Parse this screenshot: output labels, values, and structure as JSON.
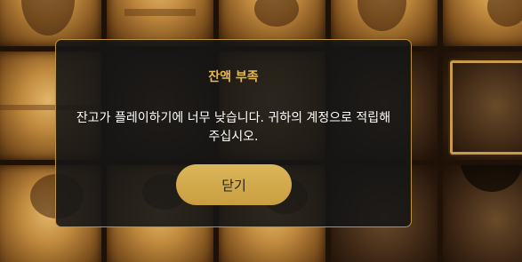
{
  "dialog": {
    "title": "잔액 부족",
    "message": "잔고가 플레이하기에 너무 낮습니다. 귀하의 계정으로 적립해 주십시오.",
    "close_label": "닫기"
  },
  "colors": {
    "title": "#e7b94a",
    "button": "#d4ab4d",
    "modal_border": "#b8923c",
    "modal_bg": "#161616"
  }
}
